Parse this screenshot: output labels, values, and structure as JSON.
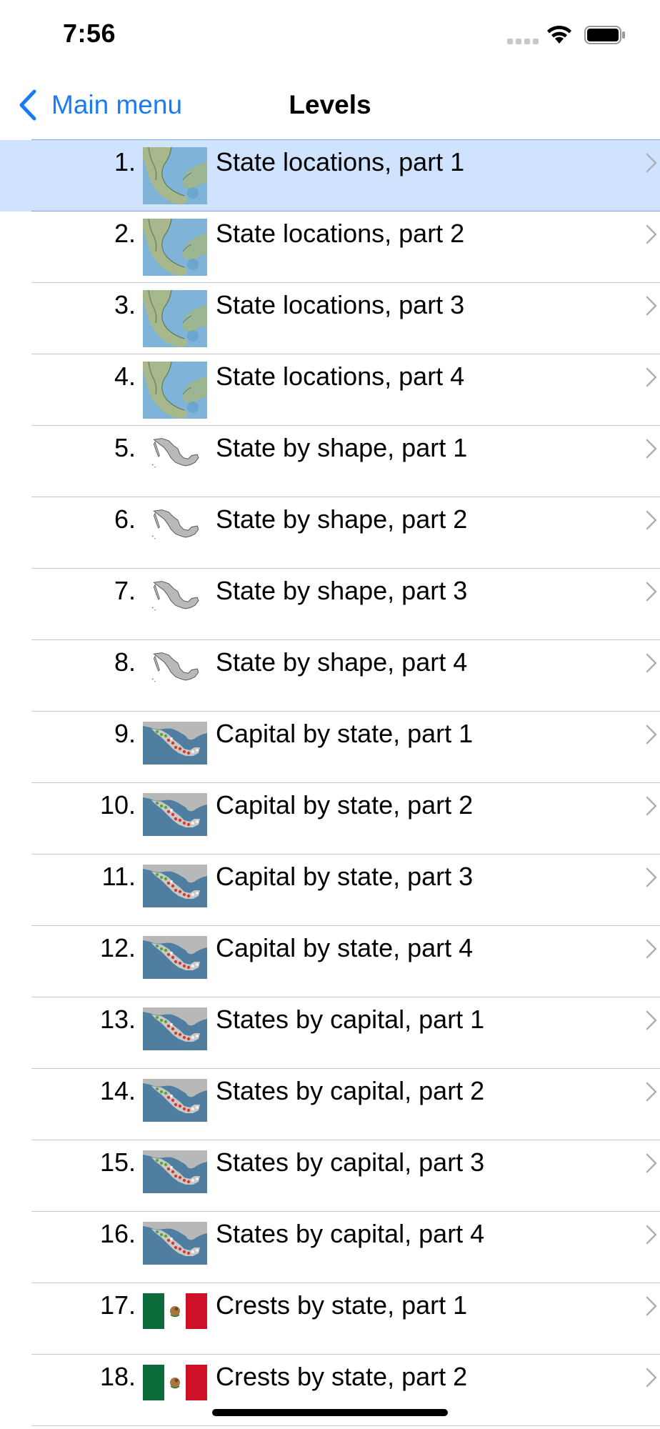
{
  "status_bar": {
    "time": "7:56",
    "icons": [
      "cellular-signal-icon",
      "wifi-icon",
      "battery-icon"
    ]
  },
  "nav": {
    "back_label": "Main menu",
    "title": "Levels"
  },
  "colors": {
    "accent": "#1a7cf5",
    "selected_row": "#cfe3ff",
    "separator": "#c8c7cc"
  },
  "levels": [
    {
      "number": "1.",
      "title": "State locations, part 1",
      "thumb": "terrain-map",
      "selected": true
    },
    {
      "number": "2.",
      "title": "State locations, part 2",
      "thumb": "terrain-map"
    },
    {
      "number": "3.",
      "title": "State locations, part 3",
      "thumb": "terrain-map"
    },
    {
      "number": "4.",
      "title": "State locations, part 4",
      "thumb": "terrain-map"
    },
    {
      "number": "5.",
      "title": "State by shape, part 1",
      "thumb": "shape-map"
    },
    {
      "number": "6.",
      "title": "State by shape, part 2",
      "thumb": "shape-map"
    },
    {
      "number": "7.",
      "title": "State by shape, part 3",
      "thumb": "shape-map"
    },
    {
      "number": "8.",
      "title": "State by shape, part 4",
      "thumb": "shape-map"
    },
    {
      "number": "9.",
      "title": "Capital by state, part 1",
      "thumb": "capitals-map"
    },
    {
      "number": "10.",
      "title": "Capital by state, part 2",
      "thumb": "capitals-map"
    },
    {
      "number": "11.",
      "title": "Capital by state, part 3",
      "thumb": "capitals-map"
    },
    {
      "number": "12.",
      "title": "Capital by state, part 4",
      "thumb": "capitals-map"
    },
    {
      "number": "13.",
      "title": "States by capital, part 1",
      "thumb": "capitals-map"
    },
    {
      "number": "14.",
      "title": "States by capital, part 2",
      "thumb": "capitals-map"
    },
    {
      "number": "15.",
      "title": "States by capital, part 3",
      "thumb": "capitals-map"
    },
    {
      "number": "16.",
      "title": "States by capital, part 4",
      "thumb": "capitals-map"
    },
    {
      "number": "17.",
      "title": "Crests by state, part 1",
      "thumb": "mexico-flag"
    },
    {
      "number": "18.",
      "title": "Crests by state, part 2",
      "thumb": "mexico-flag"
    }
  ]
}
